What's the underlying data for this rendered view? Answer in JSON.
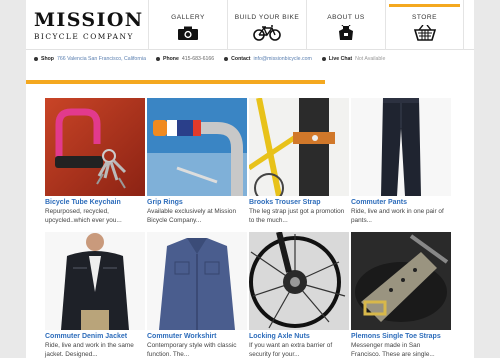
{
  "brand": {
    "name": "MISSION",
    "tagline": "BICYCLE COMPANY"
  },
  "nav": [
    {
      "label": "GALLERY",
      "icon": "camera-icon",
      "active": false
    },
    {
      "label": "BUILD YOUR BIKE",
      "icon": "bicycle-icon",
      "active": false
    },
    {
      "label": "ABOUT US",
      "icon": "apron-icon",
      "active": false
    },
    {
      "label": "STORE",
      "icon": "basket-icon",
      "active": true
    }
  ],
  "info": {
    "shop_label": "Shop",
    "shop_value": "766 Valencia San Francisco, California",
    "phone_label": "Phone",
    "phone_value": "415-683-6166",
    "contact_label": "Contact",
    "contact_value": "info@missionbicycle.com",
    "chat_label": "Live Chat",
    "chat_value": "Not Available"
  },
  "colors": {
    "accent": "#f4a81f",
    "link": "#2e6dbb"
  },
  "products": [
    {
      "title": "Bicycle Tube Keychain",
      "desc": "Repurposed, recycled, upcycled..which ever you...",
      "image": "keychain"
    },
    {
      "title": "Grip Rings",
      "desc": "Available exclusively at Mission Bicycle Company...",
      "image": "grip"
    },
    {
      "title": "Brooks Trouser Strap",
      "desc": "The leg strap just got a promotion to the much...",
      "image": "strap"
    },
    {
      "title": "Commuter Pants",
      "desc": "Ride, live and work in one pair of pants...",
      "image": "pants"
    },
    {
      "title": "Commuter Denim Jacket",
      "desc": "Ride, live and work in the same jacket. Designed...",
      "image": "jacket"
    },
    {
      "title": "Commuter Workshirt",
      "desc": "Contemporary style with classic function. The...",
      "image": "shirt"
    },
    {
      "title": "Locking Axle Nuts",
      "desc": "If you want an extra barrier of security for your...",
      "image": "axle"
    },
    {
      "title": "Plemons Single Toe Straps",
      "desc": "Messenger made in San Francisco. These are single...",
      "image": "toestrap"
    }
  ]
}
